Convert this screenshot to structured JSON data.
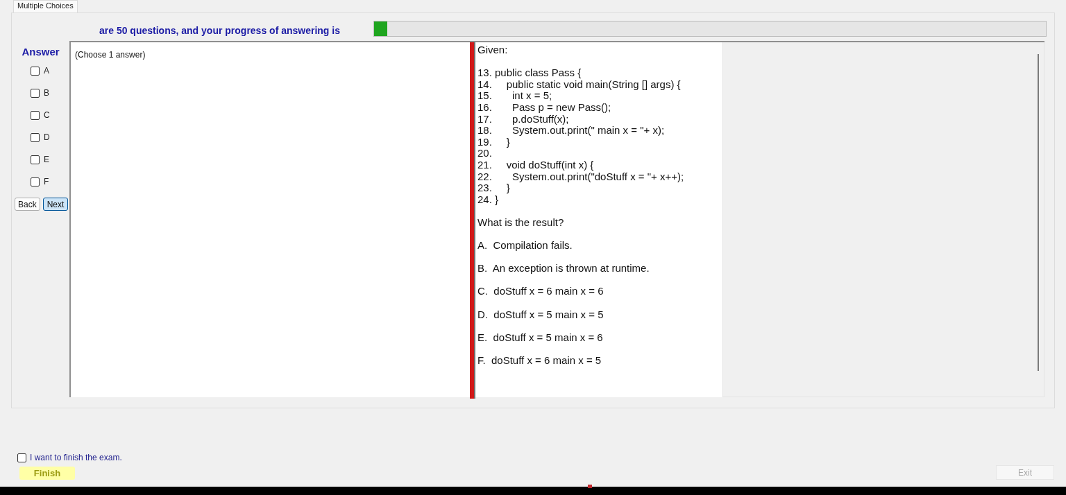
{
  "tabs": [
    {
      "label": "Multiple Choices",
      "selected": true
    }
  ],
  "header": {
    "text": "are 50 questions, and your progress of answering is",
    "progress": {
      "level": 0.02
    }
  },
  "answer_panel": {
    "title": "Answer",
    "options": [
      {
        "label": "A",
        "checked": false
      },
      {
        "label": "B",
        "checked": false
      },
      {
        "label": "C",
        "checked": false
      },
      {
        "label": "D",
        "checked": false
      },
      {
        "label": "E",
        "checked": false
      },
      {
        "label": "F",
        "checked": false
      }
    ],
    "buttons": [
      {
        "label": "Back",
        "focused": false
      },
      {
        "label": "Next",
        "focused": true
      }
    ]
  },
  "answer_box": {
    "text": "(Choose 1 answer)"
  },
  "question": {
    "intro": "Given:",
    "code_lines": [
      "13. public class Pass {",
      "14.     public static void main(String [] args) {",
      "15.       int x = 5;",
      "16.       Pass p = new Pass();",
      "17.       p.doStuff(x);",
      "18.       System.out.print(\" main x = \"+ x);",
      "19.     }",
      "20.",
      "21.     void doStuff(int x) {",
      "22.       System.out.print(\"doStuff x = \"+ x++);",
      "23.     }",
      "24. }"
    ],
    "prompt": "What is the result?",
    "choices": [
      "A.  Compilation fails.",
      "B.  An exception is thrown at runtime.",
      "C.  doStuff x = 6 main x = 6",
      "D.  doStuff x = 5 main x = 5",
      "E.  doStuff x = 5 main x = 6",
      "F.  doStuff x = 6 main x = 5"
    ]
  },
  "footer": {
    "finish_checkbox": {
      "label": "I want to finish the exam.",
      "checked": false
    },
    "finish_button": {
      "label": "Finish"
    },
    "exit_button": {
      "label": "Exit",
      "disabled": true
    }
  }
}
